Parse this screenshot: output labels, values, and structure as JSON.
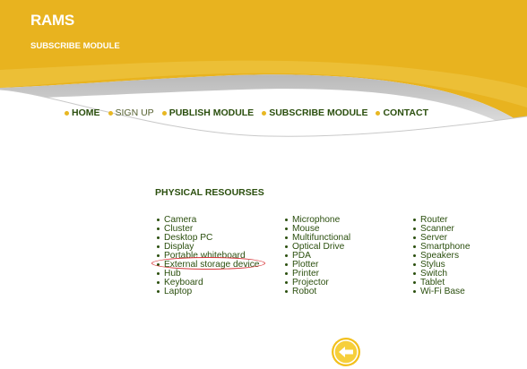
{
  "app": {
    "title": "RAMS",
    "subtitle": "SUBSCRIBE MODULE"
  },
  "nav": [
    {
      "label": "HOME",
      "muted": false
    },
    {
      "label": "SIGN UP",
      "muted": true
    },
    {
      "label": "PUBLISH MODULE",
      "muted": false
    },
    {
      "label": "SUBSCRIBE MODULE",
      "muted": false
    },
    {
      "label": "CONTACT",
      "muted": false
    }
  ],
  "section": {
    "title": "PHYSICAL RESOURSES"
  },
  "resources": {
    "column1": [
      "Camera",
      "Cluster",
      "Desktop PC",
      "Display",
      "Portable whiteboard",
      "External storage device",
      "Hub",
      "Keyboard",
      "Laptop"
    ],
    "column2": [
      "Microphone",
      "Mouse",
      "Multifunctional",
      "Optical Drive",
      "PDA",
      "Plotter",
      "Printer",
      "Projector",
      "Robot"
    ],
    "column3": [
      "Router",
      "Scanner",
      "Server",
      "Smartphone",
      "Speakers",
      "Stylus",
      "Switch",
      "Tablet",
      "Wi-Fi Base"
    ]
  },
  "highlighted_item": "Portable whiteboard",
  "colors": {
    "header_yellow": "#e8b31f",
    "header_yellow_light": "#f0c74a",
    "text_green": "#2b4f0e",
    "nav_bullet": "#e8b722",
    "highlight_red": "#d8363a",
    "back_button": "#f2c01c"
  },
  "icons": {
    "back_button": "left-arrow-circle-icon",
    "nav_bullet": "bullet-dot-icon"
  }
}
